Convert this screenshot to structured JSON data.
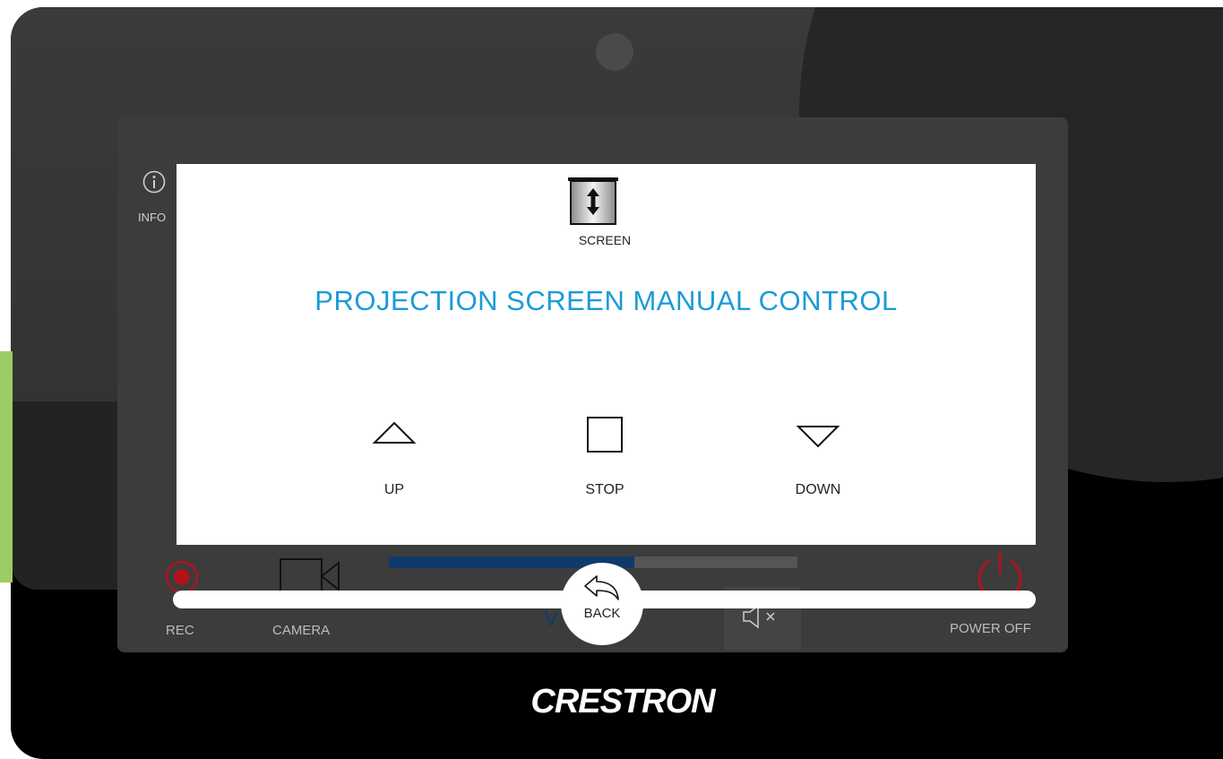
{
  "background": {
    "info_label": "INFO",
    "rec_label": "REC",
    "camera_label": "CAMERA",
    "volume_label": "V",
    "volume_level_percent": 60,
    "power_label": "POWER OFF"
  },
  "modal": {
    "screen_label": "SCREEN",
    "title": "PROJECTION SCREEN MANUAL CONTROL",
    "controls": {
      "up_label": "UP",
      "stop_label": "STOP",
      "down_label": "DOWN"
    },
    "back_label": "BACK"
  },
  "brand": "CRESTRON",
  "colors": {
    "title": "#1a9bd7",
    "accent_green": "#9ccc65",
    "rec_red": "#b0131b",
    "volume_fill": "#0e3a6b"
  }
}
